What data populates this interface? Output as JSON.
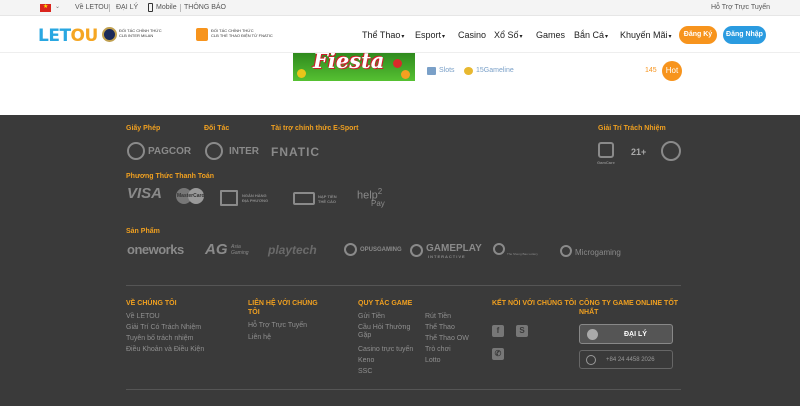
{
  "topbar": {
    "about": "Về LETOU",
    "agent": "ĐẠI LÝ",
    "mobile": "Mobile",
    "notice": "THÔNG BÁO",
    "support": "Hỗ Trợ Trực Tuyến"
  },
  "header": {
    "logo_a": "LET",
    "logo_b": "OU",
    "partner1_line1": "ĐỐI TÁC CHÍNH THỨC",
    "partner1_line2": "CLB INTER MILAN",
    "partner2_line1": "ĐỐI TÁC CHÍNH THỨC",
    "partner2_line2": "CLB THỂ THAO ĐIỆN TỬ FNATIC",
    "nav": [
      "Thể Thao",
      "Esport",
      "Casino",
      "Xổ Số",
      "Games",
      "Bắn Cá",
      "Khuyến Mãi"
    ],
    "register": "Đăng Ký",
    "login": "Đăng Nhập"
  },
  "game": {
    "title_art": "Fiesta",
    "category": "Slots",
    "provider": "15Gameline",
    "count": "145",
    "badge": "Hot"
  },
  "footer": {
    "license_title": "Giấy Phép",
    "partner_title": "Đối Tác",
    "esport_title": "Tài trợ chính thức E-Sport",
    "responsible_title": "Giải Trí Trách Nhiệm",
    "license_logo": "PAGCOR",
    "partner_logo": "INTER",
    "esport_logo": "FNATIC",
    "gamcare": "GamCare",
    "age": "21+",
    "payment_title": "Phương Thức Thanh Toán",
    "payments": {
      "visa": "VISA",
      "mastercard": "MasterCard",
      "bank_l1": "NGÂN HÀNG",
      "bank_l2": "ĐỊA PHƯƠNG",
      "card_l1": "NẠP TIỀN",
      "card_l2": "THẺ CÀO",
      "help2pay_a": "help",
      "help2pay_b": "2",
      "help2pay_c": "Pay"
    },
    "products_title": "Sản Phẩm",
    "products": {
      "oneworks": "oneworks",
      "ag": "AG",
      "ag_sub1": "Asia",
      "ag_sub2": "Gaming",
      "playtech": "playtech",
      "opus": "OPUSGAMING",
      "gameplay": "GAMEPLAY",
      "gameplay_sub": "INTERACTIVE",
      "bbin": "The Sheng Bao Lottery",
      "microgaming": "Microgaming"
    },
    "col_about_title": "VỀ CHÚNG TÔI",
    "col_about": [
      "Về LETOU",
      "Giải Trí Có Trách Nhiệm",
      "Tuyên bố trách nhiệm",
      "Điều Khoản và Điều Kiện"
    ],
    "col_contact_title": "LIÊN HỆ VỚI CHÚNG TÔI",
    "col_contact": [
      "Hỗ Trợ Trực Tuyến",
      "Liên hệ"
    ],
    "col_rules_title": "QUY TẮC GAME",
    "col_rules_a": [
      "Gửi Tiền",
      "Cầu Hỏi Thường Gặp",
      "Casino trực tuyến",
      "Keno",
      "SSC"
    ],
    "col_rules_b": [
      "Rút Tiền",
      "Thể Thao",
      "Thể Thao OW",
      "Trò chơi",
      "Lotto"
    ],
    "col_connect_title": "KẾT NỐI VỚI CHÚNG TÔI",
    "col_company_title": "CÔNG TY GAME ONLINE TỐT NHẤT",
    "agent_button": "ĐẠI LÝ",
    "phone": "+84 24 4458 2026"
  }
}
